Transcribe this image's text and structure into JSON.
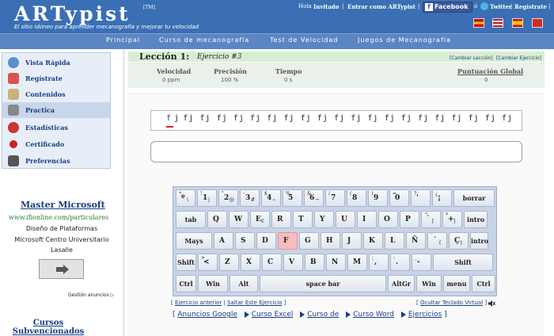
{
  "header": {
    "logo": "ARTypist",
    "tm": "[TM]",
    "tagline": "El sitio idóneo para aprender mecanografía y mejorar tu velocidad",
    "hola": "Hola",
    "invitado": "Invitado",
    "entrar": "Entrar como ARTypist",
    "facebook": "Facebook",
    "twitter": "Twitter",
    "registrate": "Regístrate",
    "sep": "|",
    "o": "ó"
  },
  "nav": [
    "Principal",
    "Curso de mecanografía",
    "Test de Velocidad",
    "Juegos de Mecanografía"
  ],
  "sidebar": [
    {
      "label": "Vista Rápida",
      "icon": "globe-icon",
      "color": "#5a8fd0"
    },
    {
      "label": "Regístrate",
      "icon": "free-icon",
      "color": "#d9534f"
    },
    {
      "label": "Contenidos",
      "icon": "book-icon",
      "color": "#c8b27a"
    },
    {
      "label": "Practica",
      "icon": "keyboard-icon",
      "color": "#888888"
    },
    {
      "label": "Estadísticas",
      "icon": "chart-icon",
      "color": "#cc3333"
    },
    {
      "label": "Certificado",
      "icon": "certificate-icon",
      "color": "#cc2222"
    },
    {
      "label": "Preferencias",
      "icon": "tools-icon",
      "color": "#555555"
    }
  ],
  "ad": {
    "title": "Master Microsoft",
    "url": "www.ifionline.com/particulares",
    "line1": "Diseño de Plataformas",
    "line2": "Microsoft Centro Universitario",
    "line3": "Lasalle",
    "gestion": "Gestión anuncios",
    "cursos": "Cursos Subvencionados"
  },
  "lesson": {
    "title": "Lección 1:",
    "sub": "Ejercicio #3",
    "change_lesson": "[Cambiar Lección]",
    "change_exercise": "[Cambiar Ejercicio]"
  },
  "stats": {
    "velocidad_label": "Velocidad",
    "velocidad": "0 ppm",
    "precision_label": "Precisión",
    "precision": "100 %",
    "tiempo_label": "Tiempo",
    "tiempo": "0 s",
    "puntuacion_label": "Puntuación Global",
    "puntuacion": "0"
  },
  "exercise": {
    "first_char": "f",
    "first_rest": "j",
    "word": "fj",
    "count": 21
  },
  "keyboard": {
    "row1": [
      {
        "s": "ª",
        "m": "º",
        "a": "\\"
      },
      {
        "s": "!",
        "m": "1",
        "a": "|"
      },
      {
        "s": "\"",
        "m": "2",
        "a": "@"
      },
      {
        "s": "·",
        "m": "3",
        "a": "#"
      },
      {
        "s": "$",
        "m": "4",
        "a": "~"
      },
      {
        "s": "%",
        "m": "5",
        "a": ""
      },
      {
        "s": "&",
        "m": "6",
        "a": "¬"
      },
      {
        "s": "/",
        "m": "7",
        "a": ""
      },
      {
        "s": "(",
        "m": "8",
        "a": ""
      },
      {
        "s": ")",
        "m": "9",
        "a": ""
      },
      {
        "s": "=",
        "m": "0",
        "a": ""
      },
      {
        "s": "?",
        "m": "'",
        "a": ""
      },
      {
        "s": "¿",
        "m": "¡",
        "a": ""
      }
    ],
    "row2": [
      {
        "m": "Q"
      },
      {
        "m": "W"
      },
      {
        "m": "E",
        "a": "€"
      },
      {
        "m": "R"
      },
      {
        "m": "T"
      },
      {
        "m": "Y"
      },
      {
        "m": "U"
      },
      {
        "m": "I"
      },
      {
        "m": "O"
      },
      {
        "m": "P"
      },
      {
        "s": "^",
        "m": "`",
        "a": "["
      },
      {
        "s": "*",
        "m": "+",
        "a": "]"
      }
    ],
    "row3": [
      {
        "m": "A"
      },
      {
        "m": "S"
      },
      {
        "m": "D"
      },
      {
        "m": "F"
      },
      {
        "m": "G"
      },
      {
        "m": "H"
      },
      {
        "m": "J"
      },
      {
        "m": "K"
      },
      {
        "m": "L"
      },
      {
        "m": "Ñ"
      },
      {
        "s": "¨",
        "m": "´",
        "a": "{"
      },
      {
        "m": "Ç",
        "a": "}"
      }
    ],
    "row4": [
      {
        "s": ">",
        "m": "<"
      },
      {
        "m": "Z"
      },
      {
        "m": "X"
      },
      {
        "m": "C"
      },
      {
        "m": "V"
      },
      {
        "m": "B"
      },
      {
        "m": "N"
      },
      {
        "m": "M"
      },
      {
        "s": ";",
        "m": ","
      },
      {
        "s": ":",
        "m": "."
      },
      {
        "s": "_",
        "m": "-"
      }
    ],
    "borrar": "borrar",
    "tab": "tab",
    "intro": "intro",
    "mays": "Mays",
    "shift": "Shift",
    "ctrl": "Ctrl",
    "win": "Win",
    "alt": "Alt",
    "space": "space bar",
    "altgr": "AltGr",
    "menu": "menu"
  },
  "links": {
    "prev": "Ejercicio anterior",
    "skip": "Saltar Este Ejercicio",
    "hide_kb": "Ocultar Teclado Virtual",
    "bar": [
      "Anuncios Google",
      "Curso Excel",
      "Curso de",
      "Curso Word",
      "Ejercicios"
    ]
  }
}
